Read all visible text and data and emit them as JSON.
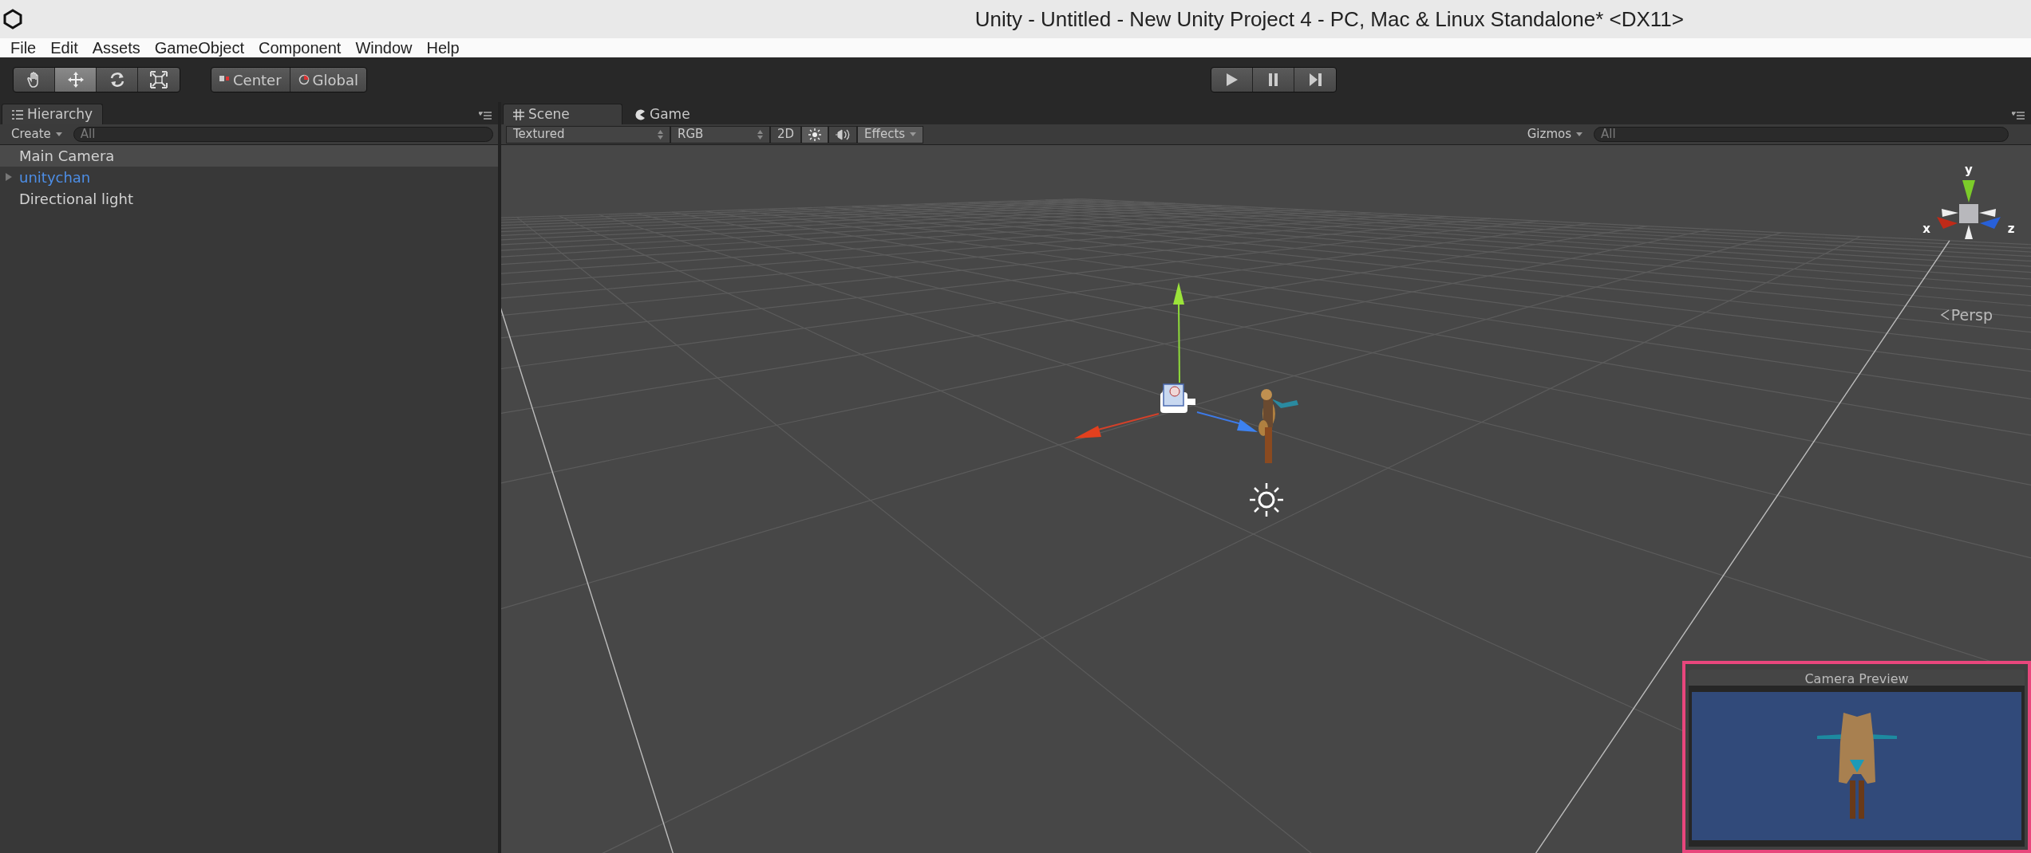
{
  "window": {
    "title": "Unity - Untitled - New Unity Project 4 - PC, Mac & Linux Standalone* <DX11>"
  },
  "menu": [
    "File",
    "Edit",
    "Assets",
    "GameObject",
    "Component",
    "Window",
    "Help"
  ],
  "tools": [
    {
      "kind": "hand",
      "selected": false
    },
    {
      "kind": "move",
      "selected": true
    },
    {
      "kind": "rotate",
      "selected": false
    },
    {
      "kind": "scale",
      "selected": false
    }
  ],
  "pivot": [
    {
      "kind": "center",
      "label": "Center"
    },
    {
      "kind": "global",
      "label": "Global"
    }
  ],
  "playback": [
    {
      "kind": "play"
    },
    {
      "kind": "pause"
    },
    {
      "kind": "step"
    }
  ],
  "hierarchy": {
    "tab": "Hierarchy",
    "create": "Create",
    "search": {
      "placeholder": "All"
    },
    "items": [
      {
        "label": "Main Camera",
        "kind": "object",
        "selected": true
      },
      {
        "label": "unitychan",
        "kind": "prefab",
        "expanded": false,
        "selected": false
      },
      {
        "label": "Directional light",
        "kind": "object",
        "selected": false
      }
    ]
  },
  "scene": {
    "tabs": [
      {
        "label": "Scene",
        "kind": "scene",
        "selected": true
      },
      {
        "label": "Game",
        "kind": "game",
        "selected": false
      }
    ],
    "toolbar": {
      "draw_mode": "Textured",
      "render_mode": "RGB",
      "mode_2d": {
        "label": "2D",
        "on": false
      },
      "lighting": {
        "on": true
      },
      "audio": {
        "on": false
      },
      "effects": {
        "label": "Effects",
        "on": true
      },
      "gizmos": "Gizmos",
      "search": {
        "placeholder": "All"
      }
    },
    "view_gizmo": {
      "axes": [
        {
          "label": "y"
        },
        {
          "label": "x"
        },
        {
          "label": "z"
        }
      ],
      "projection": "Persp"
    },
    "camera_preview": {
      "title": "Camera Preview"
    }
  }
}
